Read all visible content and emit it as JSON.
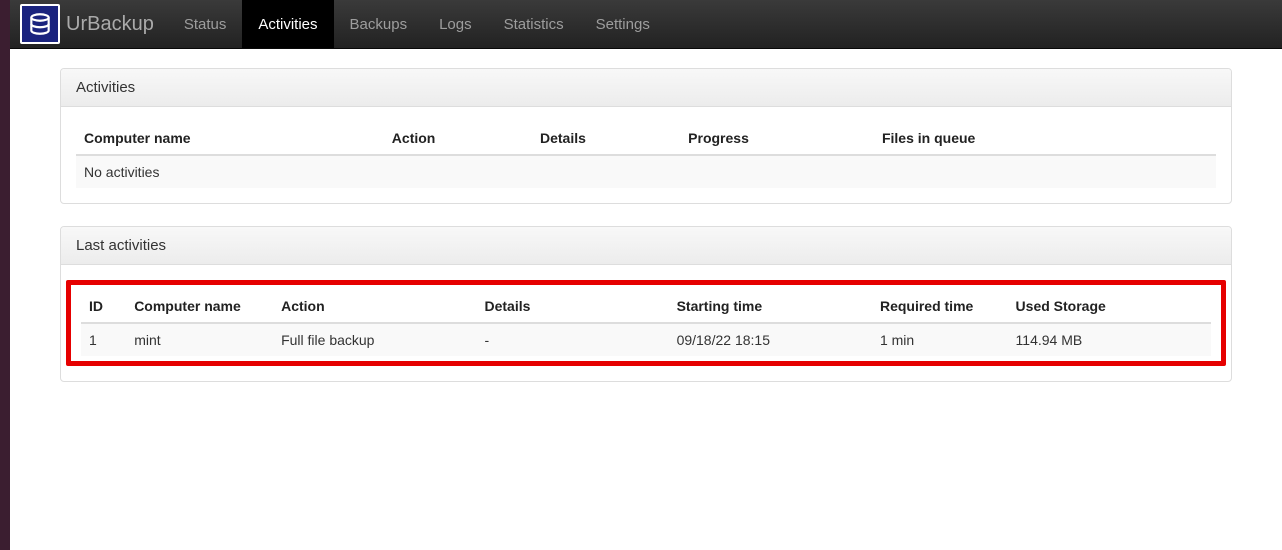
{
  "brand": {
    "name": "UrBackup"
  },
  "nav": {
    "items": [
      {
        "label": "Status",
        "active": false
      },
      {
        "label": "Activities",
        "active": true
      },
      {
        "label": "Backups",
        "active": false
      },
      {
        "label": "Logs",
        "active": false
      },
      {
        "label": "Statistics",
        "active": false
      },
      {
        "label": "Settings",
        "active": false
      }
    ]
  },
  "activities_panel": {
    "title": "Activities",
    "columns": {
      "computer_name": "Computer name",
      "action": "Action",
      "details": "Details",
      "progress": "Progress",
      "files_in_queue": "Files in queue"
    },
    "empty_message": "No activities"
  },
  "last_activities_panel": {
    "title": "Last activities",
    "columns": {
      "id": "ID",
      "computer_name": "Computer name",
      "action": "Action",
      "details": "Details",
      "starting_time": "Starting time",
      "required_time": "Required time",
      "used_storage": "Used Storage"
    },
    "rows": [
      {
        "id": "1",
        "computer_name": "mint",
        "action": "Full file backup",
        "details": "-",
        "starting_time": "09/18/22 18:15",
        "required_time": "1 min",
        "used_storage": "114.94 MB"
      }
    ]
  }
}
